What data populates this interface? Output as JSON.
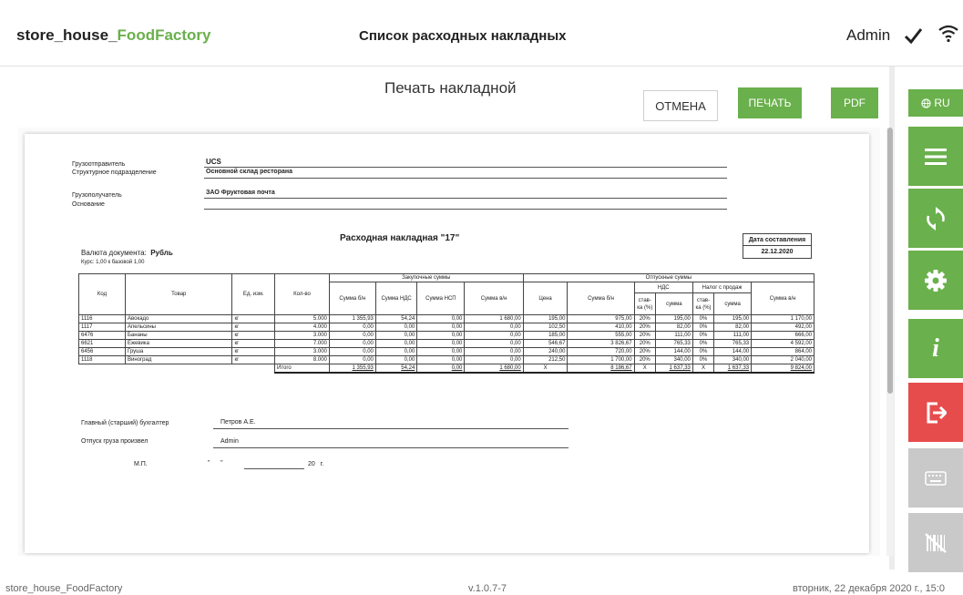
{
  "header": {
    "app_name_part1": "store_house_",
    "app_name_part2": "FoodFactory",
    "screen_title": "Список расходных накладных",
    "user": "Admin"
  },
  "dialog": {
    "title": "Печать накладной",
    "cancel": "ОТМЕНА",
    "print": "ПЕЧАТЬ",
    "pdf": "PDF"
  },
  "sidebar": {
    "lang": "RU",
    "buttons": [
      "menu-icon",
      "sync-icon",
      "settings-icon",
      "info-icon",
      "logout-icon",
      "keyboard-icon",
      "barcode-off-icon"
    ]
  },
  "doc": {
    "sender_label": "Грузоотправитель",
    "sender_value": "UCS",
    "unit_label": "Структурное подразделение",
    "unit_value": "Основной склад ресторана",
    "receiver_label": "Грузополучатель",
    "receiver_value": "ЗАО Фруктовая почта",
    "basis_label": "Основание",
    "title": "Расходная накладная \"17\"",
    "date_label": "Дата составления",
    "date_value": "22.12.2020",
    "currency_label": "Валюта документа:",
    "currency_value": "Рубль",
    "rate": "Курс: 1,00 к базовой 1,00",
    "headers": {
      "code": "Код",
      "item": "Товар",
      "unit": "Ед. изм.",
      "qty": "Кол-во",
      "purchase_group": "Закупочные суммы",
      "sum_no_vat": "Сумма б/н",
      "sum_vat": "Сумма НДС",
      "sum_nsp": "Сумма НСП",
      "sum_total": "Сумма в/н",
      "release_group": "Отпускные суммы",
      "price": "Цена",
      "rel_sum_no_vat": "Сумма б/н",
      "vat_group": "НДС",
      "rate": "став-ка (%)",
      "amount": "сумма",
      "sales_tax_group": "Налог с продаж",
      "rel_sum_total": "Сумма в/н"
    },
    "rows": [
      [
        "1116",
        "Авокадо",
        "кг",
        "5.000",
        "1 355,93",
        "54,24",
        "0,00",
        "1 680,00",
        "195,00",
        "975,00",
        "20%",
        "195,00",
        "0%",
        "195,00",
        "1 170,00"
      ],
      [
        "1117",
        "Апельсины",
        "кг",
        "4.000",
        "0,00",
        "0,00",
        "0,00",
        "0,00",
        "102,50",
        "410,00",
        "20%",
        "82,00",
        "0%",
        "82,00",
        "492,00"
      ],
      [
        "6476",
        "Бананы",
        "кг",
        "3.000",
        "0,00",
        "0,00",
        "0,00",
        "0,00",
        "185,00",
        "555,00",
        "20%",
        "111,00",
        "0%",
        "111,00",
        "666,00"
      ],
      [
        "6621",
        "Ежевика",
        "кг",
        "7.000",
        "0,00",
        "0,00",
        "0,00",
        "0,00",
        "546,67",
        "3 826,67",
        "20%",
        "765,33",
        "0%",
        "765,33",
        "4 592,00"
      ],
      [
        "6456",
        "Груша",
        "кг",
        "3.000",
        "0,00",
        "0,00",
        "0,00",
        "0,00",
        "240,00",
        "720,00",
        "20%",
        "144,00",
        "0%",
        "144,00",
        "864,00"
      ],
      [
        "1118",
        "Виноград",
        "кг",
        "8.000",
        "0,00",
        "0,00",
        "0,00",
        "0,00",
        "212,50",
        "1 700,00",
        "20%",
        "340,00",
        "0%",
        "340,00",
        "2 040,00"
      ]
    ],
    "total": [
      "Итого",
      "1 355,93",
      "54,24",
      "0,00",
      "1 680,00",
      "X",
      "8 186,67",
      "X",
      "1 637,33",
      "X",
      "1 637,33",
      "9 824,00"
    ],
    "accountant_label": "Главный (старший) бухгалтер",
    "accountant_value": "Петров А.Е.",
    "released_label": "Отпуск груза произвел",
    "released_value": "Admin",
    "stamp": "М.П.",
    "date_line_prefix": "\"      \"",
    "date_line_suffix": "20   г."
  },
  "footer": {
    "left": "store_house_FoodFactory",
    "center": "v.1.0.7-7",
    "right": "вторник, 22 декабря 2020 г., 15:0"
  }
}
